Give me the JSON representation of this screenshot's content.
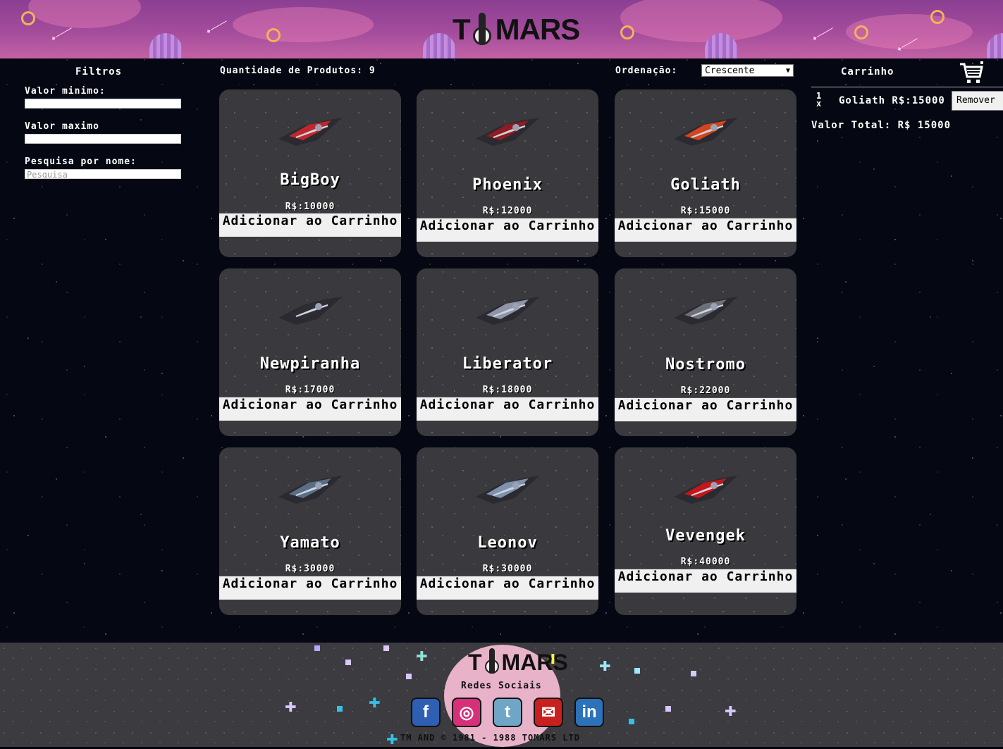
{
  "header": {
    "logo_t": "T",
    "logo_rest": "MARS"
  },
  "filters": {
    "title": "Filtros",
    "min_label": "Valor minimo:",
    "min_value": "",
    "max_label": "Valor maximo",
    "max_value": "",
    "search_label": "Pesquisa por nome:",
    "search_placeholder": "Pesquisa"
  },
  "toolbar": {
    "quantity_text": "Quantidade de Produtos: 9",
    "sort_label": "Ordenação:",
    "sort_value": "Crescente"
  },
  "products": [
    {
      "name": "BigBoy",
      "price": "R$:10000",
      "button": "Adicionar ao Carrinho",
      "ship_color": "#c0272d"
    },
    {
      "name": "Phoenix",
      "price": "R$:12000",
      "button": "Adicionar ao Carrinho",
      "ship_color": "#8e1c22"
    },
    {
      "name": "Goliath",
      "price": "R$:15000",
      "button": "Adicionar ao Carrinho",
      "ship_color": "#d2451e"
    },
    {
      "name": "Newpiranha",
      "price": "R$:17000",
      "button": "Adicionar ao Carrinho",
      "ship_color": "#2d2d33"
    },
    {
      "name": "Liberator",
      "price": "R$:18000",
      "button": "Adicionar ao Carrinho",
      "ship_color": "#8f95a8"
    },
    {
      "name": "Nostromo",
      "price": "R$:22000",
      "button": "Adicionar ao Carrinho",
      "ship_color": "#6d7077"
    },
    {
      "name": "Yamato",
      "price": "R$:30000",
      "button": "Adicionar ao Carrinho",
      "ship_color": "#5a6f86"
    },
    {
      "name": "Leonov",
      "price": "R$:30000",
      "button": "Adicionar ao Carrinho",
      "ship_color": "#7f92b0"
    },
    {
      "name": "Vevengek",
      "price": "R$:40000",
      "button": "Adicionar ao Carrinho",
      "ship_color": "#c4161c"
    }
  ],
  "cart": {
    "title": "Carrinho",
    "icon": "cart-icon",
    "items": [
      {
        "qty": "1",
        "qty_suffix": "x",
        "label": "Goliath R$:15000",
        "remove_label": "Remover"
      }
    ],
    "total_text": "Valor Total: R$ 15000"
  },
  "footer": {
    "logo_t": "T",
    "logo_rest": "MARS",
    "social_title": "Redes Sociais",
    "social": [
      {
        "name": "facebook",
        "glyph": "f",
        "color": "#2f5fb3"
      },
      {
        "name": "instagram",
        "glyph": "◎",
        "color": "#d6307a"
      },
      {
        "name": "twitter",
        "glyph": "t",
        "color": "#6fa6c6"
      },
      {
        "name": "email",
        "glyph": "✉",
        "color": "#c8201f"
      },
      {
        "name": "linkedin",
        "glyph": "in",
        "color": "#2b72b8"
      }
    ],
    "copyright": "TM AND © 1981 - 1988 TOMARS LTD"
  },
  "colors": {
    "header_gradient_top": "#8b3f93",
    "card_bg": "#3a3a3e",
    "button_bg": "#f0f0f0",
    "footer_bg": "#3b3b40"
  }
}
